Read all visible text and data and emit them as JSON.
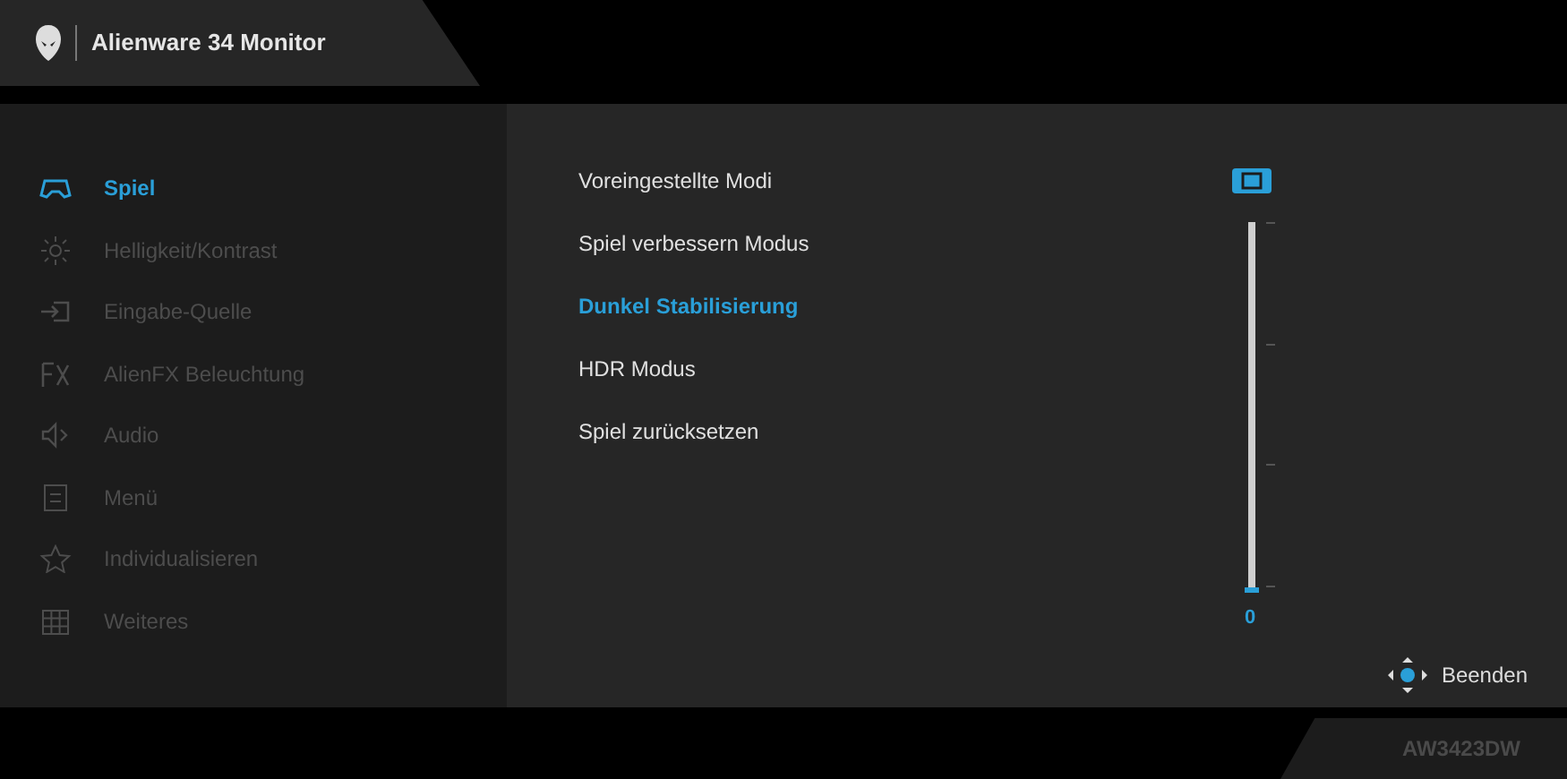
{
  "header": {
    "title": "Alienware 34 Monitor"
  },
  "sidebar": {
    "items": [
      {
        "label": "Spiel",
        "selected": true,
        "disabled": false
      },
      {
        "label": "Helligkeit/Kontrast",
        "selected": false,
        "disabled": true
      },
      {
        "label": "Eingabe-Quelle",
        "selected": false,
        "disabled": true
      },
      {
        "label": "AlienFX Beleuchtung",
        "selected": false,
        "disabled": true
      },
      {
        "label": "Audio",
        "selected": false,
        "disabled": true
      },
      {
        "label": "Menü",
        "selected": false,
        "disabled": true
      },
      {
        "label": "Individualisieren",
        "selected": false,
        "disabled": true
      },
      {
        "label": "Weiteres",
        "selected": false,
        "disabled": true
      }
    ]
  },
  "menu": {
    "items": [
      {
        "label": "Voreingestellte Modi",
        "selected": false
      },
      {
        "label": "Spiel verbessern Modus",
        "selected": false
      },
      {
        "label": "Dunkel Stabilisierung",
        "selected": true
      },
      {
        "label": "HDR Modus",
        "selected": false
      },
      {
        "label": "Spiel zurücksetzen",
        "selected": false
      }
    ]
  },
  "slider": {
    "level": 0,
    "reading": "0"
  },
  "exit": {
    "label": "Beenden"
  },
  "model": "AW3423DW"
}
